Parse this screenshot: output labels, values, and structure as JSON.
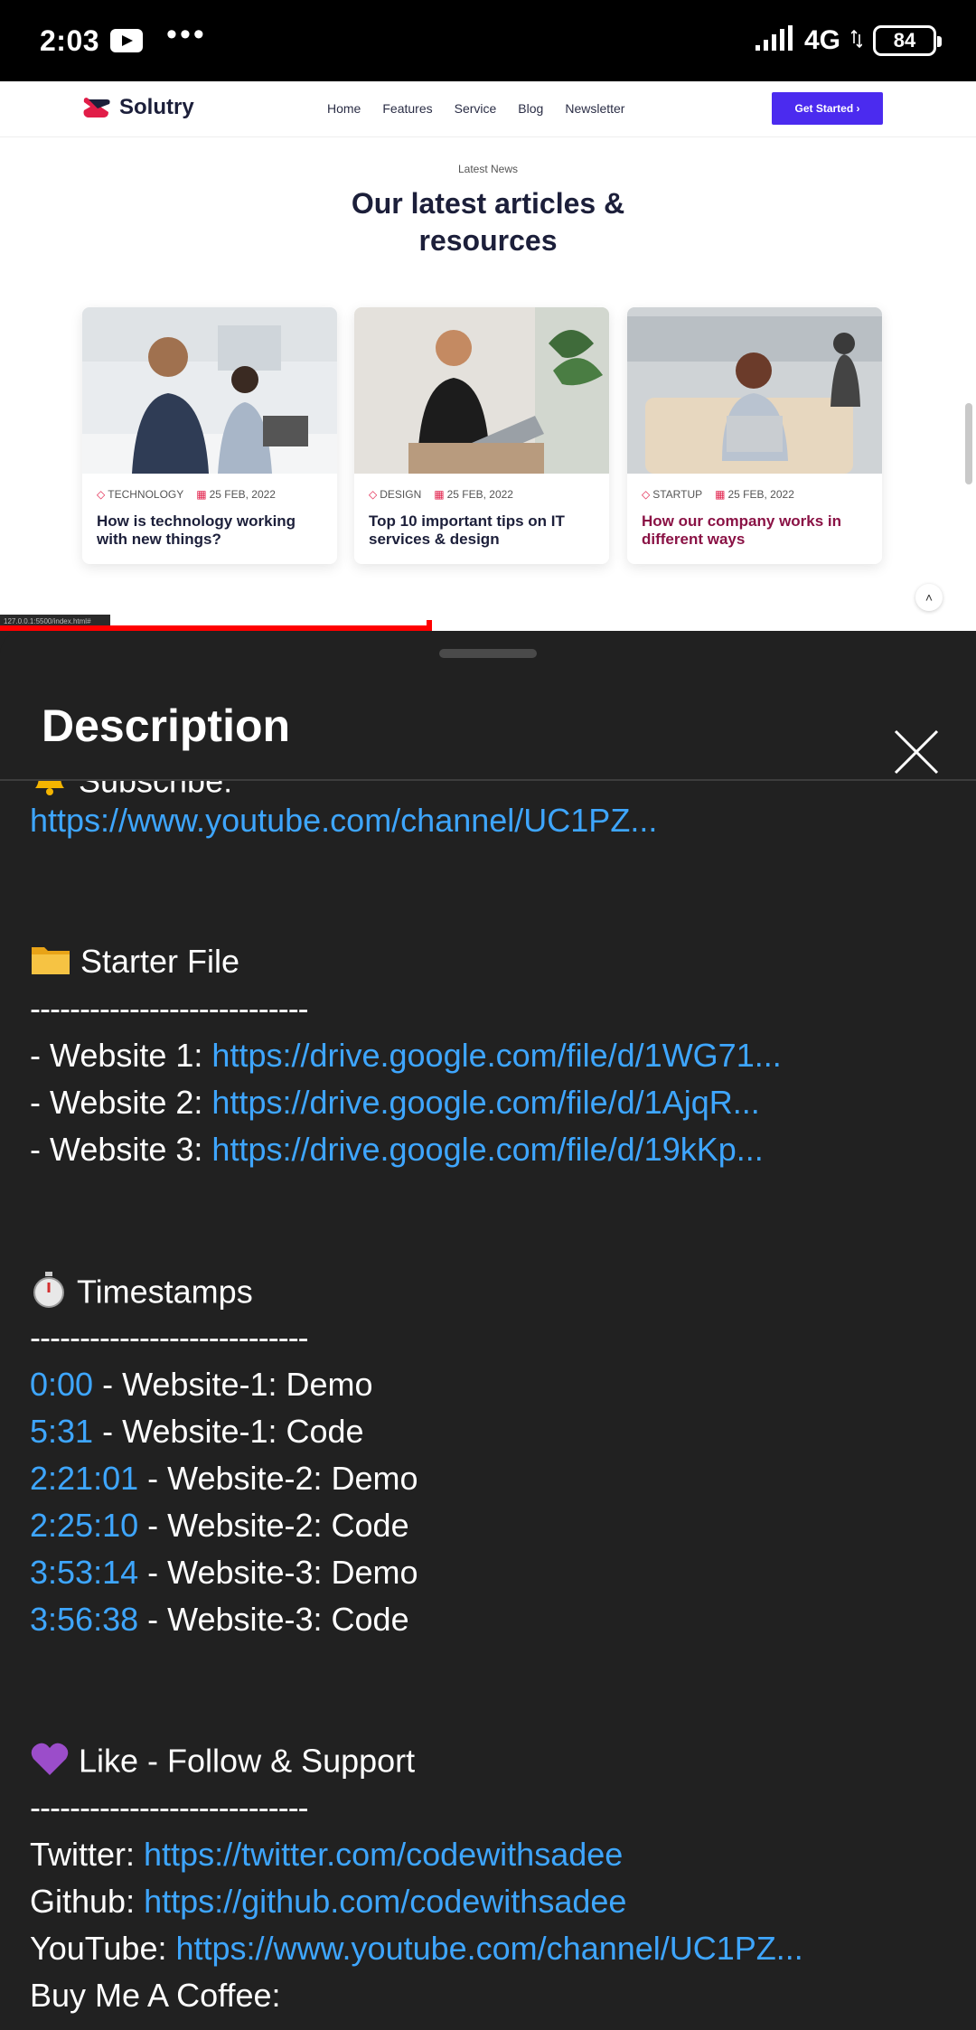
{
  "status_bar": {
    "time": "2:03",
    "more": "•••",
    "network": "4G",
    "battery": "84"
  },
  "website": {
    "brand": "Solutry",
    "nav": [
      "Home",
      "Features",
      "Service",
      "Blog",
      "Newsletter"
    ],
    "cta": "Get Started ›",
    "eyebrow": "Latest News",
    "title": "Our latest articles & resources",
    "cards": [
      {
        "tag": "TECHNOLOGY",
        "date": "25 FEB, 2022",
        "title": "How is technology working with new things?"
      },
      {
        "tag": "DESIGN",
        "date": "25 FEB, 2022",
        "title": "Top 10 important tips on IT services & design"
      },
      {
        "tag": "STARTUP",
        "date": "25 FEB, 2022",
        "title": "How our company works in different ways"
      }
    ],
    "url_chip": "127.0.0.1:5500/index.html#",
    "scroll_top_icon": "˄"
  },
  "player": {
    "progress_fraction": 0.44
  },
  "description": {
    "title": "Description",
    "subscribe_label": "Subscribe:",
    "subscribe_link": "https://www.youtube.com/channel/UC1PZ...",
    "starter_heading": "Starter File",
    "divider": "----------------------------",
    "websites": [
      {
        "label": "- Website 1: ",
        "link": "https://drive.google.com/file/d/1WG71..."
      },
      {
        "label": "- Website 2: ",
        "link": "https://drive.google.com/file/d/1AjqR..."
      },
      {
        "label": "- Website 3: ",
        "link": "https://drive.google.com/file/d/19kKp..."
      }
    ],
    "timestamps_heading": "Timestamps",
    "timestamps": [
      {
        "time": "0:00",
        "text": " - Website-1: Demo"
      },
      {
        "time": "5:31",
        "text": " - Website-1: Code"
      },
      {
        "time": "2:21:01",
        "text": " - Website-2: Demo"
      },
      {
        "time": "2:25:10",
        "text": " - Website-2: Code"
      },
      {
        "time": "3:53:14",
        "text": " - Website-3: Demo"
      },
      {
        "time": "3:56:38",
        "text": " - Website-3: Code"
      }
    ],
    "support_heading": "Like - Follow & Support",
    "socials": [
      {
        "label": "Twitter: ",
        "link": "https://twitter.com/codewithsadee"
      },
      {
        "label": "Github: ",
        "link": "https://github.com/codewithsadee"
      },
      {
        "label": "YouTube: ",
        "link": "https://www.youtube.com/channel/UC1PZ..."
      }
    ],
    "coffee_label": "Buy Me A Coffee:"
  },
  "colors": {
    "link": "#3ea6ff",
    "sheet_bg": "#212121",
    "cta": "#4b2bef",
    "progress": "#ff0000"
  }
}
